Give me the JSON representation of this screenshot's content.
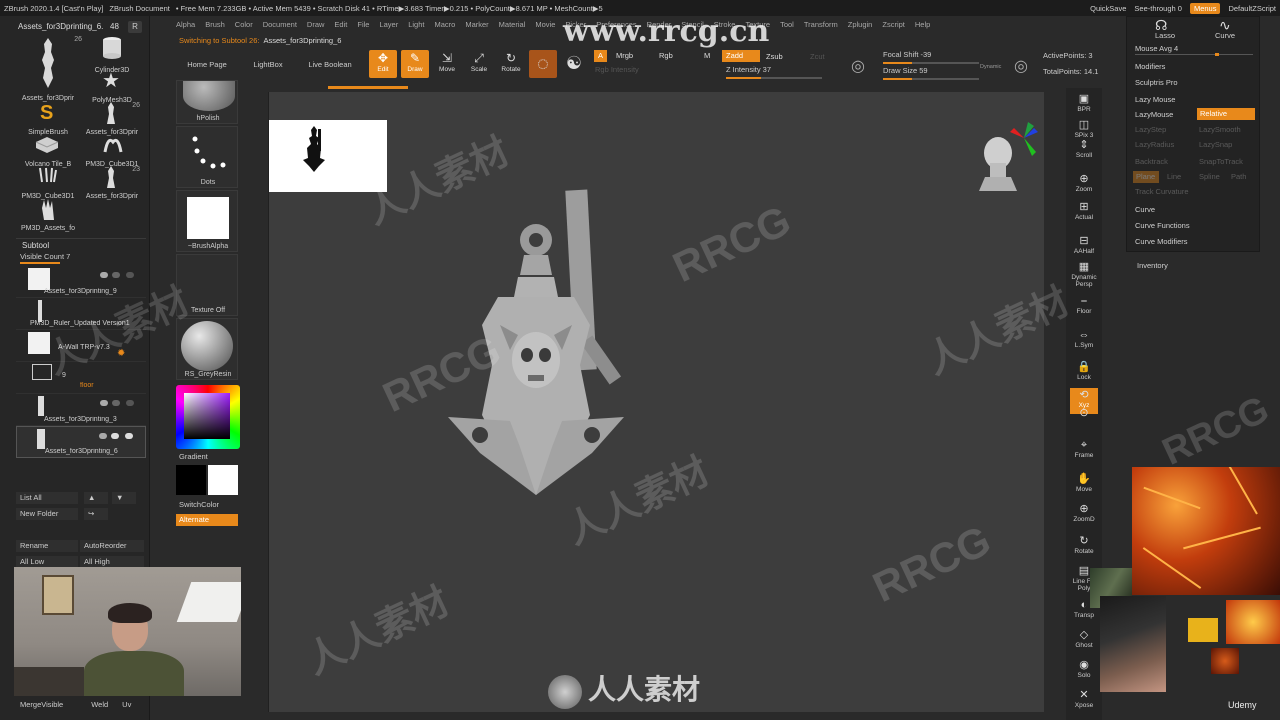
{
  "titlebar": {
    "app": "ZBrush 2020.1.4 [Cast'n Play]",
    "doc": "ZBrush Document",
    "stats": "• Free Mem 7.233GB • Active Mem 5439 • Scratch Disk 41 • RTime▶3.683 Timer▶0.215 • PolyCount▶8.671 MP • MeshCount▶5",
    "quicksave": "QuickSave",
    "see_through": "See-through",
    "see_through_val": "0",
    "menus": "Menus",
    "script": "DefaultZScript"
  },
  "menubar": [
    "Alpha",
    "Brush",
    "Color",
    "Document",
    "Draw",
    "Edit",
    "File",
    "Layer",
    "Light",
    "Macro",
    "Marker",
    "Material",
    "Movie",
    "Picker",
    "Preferences",
    "Render",
    "Stencil",
    "Stroke",
    "Texture",
    "Tool",
    "Transform",
    "Zplugin",
    "Zscript",
    "Help"
  ],
  "tool": {
    "title": "Assets_for3Dprinting_6.",
    "count": "48",
    "r": "R",
    "items": [
      {
        "label": "",
        "num": "26"
      },
      {
        "label": "Cylinder3D",
        "num": ""
      },
      {
        "label": "Assets_for3Dprir",
        "num": ""
      },
      {
        "label": "PolyMesh3D",
        "num": ""
      },
      {
        "label": "SimpleBrush",
        "num": ""
      },
      {
        "label": "Assets_for3Dprir",
        "num": "26"
      },
      {
        "label": "Volcano Tile_B",
        "num": ""
      },
      {
        "label": "PM3D_Cube3D1",
        "num": ""
      },
      {
        "label": "PM3D_Cube3D1",
        "num": ""
      },
      {
        "label": "Assets_for3Dprir",
        "num": "23"
      },
      {
        "label": "PM3D_Assets_fo",
        "num": ""
      }
    ]
  },
  "subtool": {
    "header": "Subtool",
    "visible_count": "Visible Count 7",
    "items": [
      {
        "name": "Assets_for3Dprinting_9",
        "extra": ""
      },
      {
        "name": "PM3D_Ruler_Updated Version1",
        "extra": ""
      },
      {
        "name": "A-Wall TRP-v7.3",
        "extra": ""
      },
      {
        "name": "floor",
        "extra": "9"
      },
      {
        "name": "Assets_for3Dprinting_3",
        "extra": ""
      },
      {
        "name": "Assets_for3Dprinting_6",
        "extra": ""
      }
    ],
    "list_all": "List All",
    "new_folder": "New Folder",
    "rename": "Rename",
    "auto_reorder": "AutoReorder",
    "all_low": "All Low",
    "all_high": "All High",
    "merge_visible": "MergeVisible",
    "weld": "Weld",
    "uv": "Uv"
  },
  "brushcol": {
    "items": [
      "hPolish",
      "Dots",
      "~BrushAlpha",
      "Texture Off",
      "RS_GreyResin"
    ],
    "gradient": "Gradient",
    "switch_color": "SwitchColor",
    "alternate": "Alternate"
  },
  "shelf": {
    "switching": "Switching to Subtool 26:",
    "switching_name": "Assets_for3Dprinting_6",
    "home": "Home Page",
    "lightbox": "LightBox",
    "liveboolean": "Live Boolean",
    "edit": "Edit",
    "draw": "Draw",
    "move": "Move",
    "scale": "Scale",
    "rotate": "Rotate",
    "a": "A",
    "mrgb": "Mrgb",
    "rgb": "Rgb",
    "m": "M",
    "rgb_intensity": "Rgb Intensity",
    "zadd": "Zadd",
    "zsub": "Zsub",
    "zcut": "Zcut",
    "z_intensity": "Z Intensity 37",
    "focal_shift": "Focal Shift -39",
    "draw_size": "Draw Size 59",
    "dynamic": "Dynamic",
    "active_points": "ActivePoints: 3",
    "total_points": "TotalPoints: 14.1"
  },
  "right_icons": [
    "BPR",
    "SPix 3",
    "Scroll",
    "Zoom",
    "Actual",
    "AAHalf",
    "Dynamic Persp",
    "Floor",
    "L.Sym",
    "Lock",
    "Xyz",
    "",
    "Frame",
    "Move",
    "ZoomD",
    "Rotate",
    "Line Fill Poly",
    "Transp",
    "Ghost",
    "Solo",
    "Xpose"
  ],
  "rpanel": {
    "lasso": "Lasso",
    "curve": "Curve",
    "mouse_avg": "Mouse Avg 4",
    "modifiers": "Modifiers",
    "sculptris": "Sculptris Pro",
    "lazy_mouse": "Lazy Mouse",
    "lazymouse": "LazyMouse",
    "relative": "Relative",
    "lazystep": "LazyStep",
    "lazysmooth": "LazySmooth",
    "lazyradius": "LazyRadius",
    "lazysnap": "LazySnap",
    "backtrack": "Backtrack",
    "snaptotrack": "SnapToTrack",
    "plane": "Plane",
    "line": "Line",
    "spline": "Spline",
    "path": "Path",
    "track_curvature": "Track Curvature",
    "curve2": "Curve",
    "curve_functions": "Curve Functions",
    "curve_modifiers": "Curve Modifiers",
    "inventory": "Inventory"
  },
  "watermark": {
    "url": "www.rrcg.cn",
    "cn": "人人素材",
    "rrcg": "RRCG"
  },
  "udemy": "Udemy",
  "colors": {
    "accent": "#e8891b",
    "bg": "#2a2a2a",
    "viewport": "#3d3d3d"
  }
}
